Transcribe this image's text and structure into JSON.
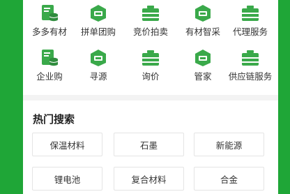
{
  "categories_row1": [
    {
      "label": "多多有材",
      "icon": "document-db-icon"
    },
    {
      "label": "拼单团购",
      "icon": "price-tag-icon"
    },
    {
      "label": "竞价拍卖",
      "icon": "toolbox-icon"
    },
    {
      "label": "有材智采",
      "icon": "price-tag-icon"
    },
    {
      "label": "代理服务",
      "icon": "toolbox-icon"
    }
  ],
  "categories_row2": [
    {
      "label": "企业购",
      "icon": "document-db-icon"
    },
    {
      "label": "寻源",
      "icon": "price-tag-icon"
    },
    {
      "label": "询价",
      "icon": "toolbox-icon"
    },
    {
      "label": "管家",
      "icon": "price-tag-icon"
    },
    {
      "label": "供应链服务",
      "icon": "toolbox-icon"
    }
  ],
  "hot_search": {
    "title": "热门搜索",
    "chips": [
      "保温材料",
      "石墨",
      "新能源",
      "锂电池",
      "复合材料",
      "合金"
    ]
  },
  "colors": {
    "brand_green": "#1fa637",
    "icon_green": "#3aa94a"
  }
}
